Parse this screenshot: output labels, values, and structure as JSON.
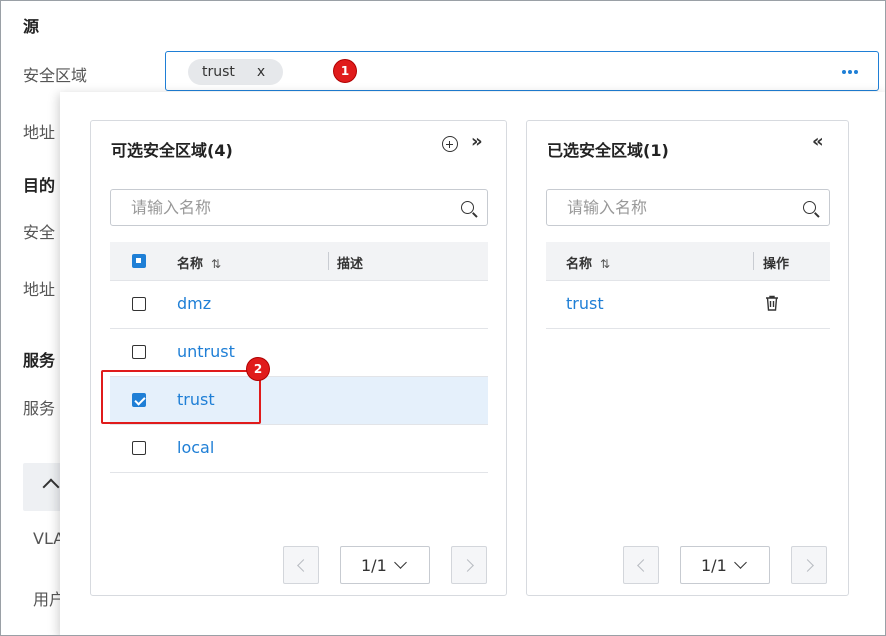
{
  "background_form": {
    "source_heading": "源",
    "security_zone_label": "安全区域",
    "address_label": "地址",
    "destination_heading": "目的",
    "dest_zone_label_partial": "安全",
    "dest_address_label": "地址",
    "service_heading": "服务",
    "service_label_partial": "服务",
    "vlan_label_partial": "VLA",
    "user_label_partial": "用户"
  },
  "zone_input": {
    "tag_label": "trust",
    "tag_close": "x",
    "more_icon": "more-horizontal-icon"
  },
  "markers": {
    "marker1": "1",
    "marker2": "2"
  },
  "left_panel": {
    "title": "可选安全区域(4)",
    "add_icon": "plus-circle-icon",
    "move_all_icon": "»",
    "search_placeholder": "请输入名称",
    "columns": {
      "name": "名称",
      "sort": "⇅",
      "desc": "描述"
    },
    "rows": [
      {
        "name": "dmz",
        "checked": false
      },
      {
        "name": "untrust",
        "checked": false
      },
      {
        "name": "trust",
        "checked": true
      },
      {
        "name": "local",
        "checked": false
      }
    ],
    "pager": {
      "value": "1/1"
    }
  },
  "right_panel": {
    "title": "已选安全区域(1)",
    "remove_all_icon": "«",
    "search_placeholder": "请输入名称",
    "columns": {
      "name": "名称",
      "sort": "⇅",
      "action": "操作"
    },
    "rows": [
      {
        "name": "trust",
        "action_icon": "trash-icon"
      }
    ],
    "pager": {
      "value": "1/1"
    }
  },
  "colors": {
    "accent": "#1f7fd6",
    "marker": "#e01b1b",
    "selected_row": "#e5f0fb"
  }
}
